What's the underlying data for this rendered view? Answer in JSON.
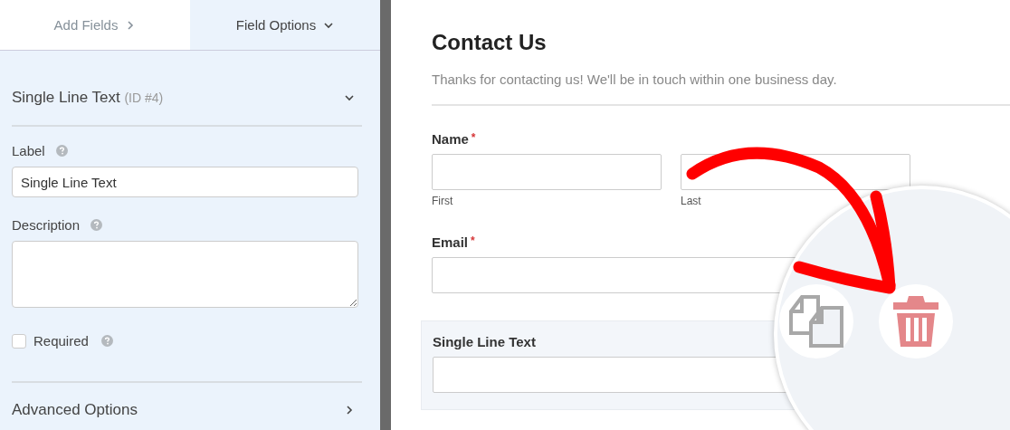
{
  "sidebar": {
    "tabs": [
      {
        "label": "Add Fields",
        "selected": false
      },
      {
        "label": "Field Options",
        "selected": true
      }
    ],
    "field_header": {
      "title": "Single Line Text",
      "id": "(ID #4)",
      "expanded": true
    },
    "label_field": {
      "label": "Label",
      "value": "Single Line Text"
    },
    "description_field": {
      "label": "Description"
    },
    "required": {
      "label": "Required",
      "checked": false
    },
    "advanced": {
      "label": "Advanced Options",
      "expanded": false
    }
  },
  "form": {
    "title": "Contact Us",
    "description": "Thanks for contacting us! We'll be in touch within one business day.",
    "fields": [
      {
        "kind": "name",
        "label": "Name",
        "required_mark": "*",
        "sublabels": [
          "First",
          "Last"
        ],
        "selected": false
      },
      {
        "kind": "text",
        "label": "Email",
        "required_mark": "*",
        "selected": false
      },
      {
        "kind": "text",
        "label": "Single Line Text",
        "selected": true
      }
    ]
  }
}
